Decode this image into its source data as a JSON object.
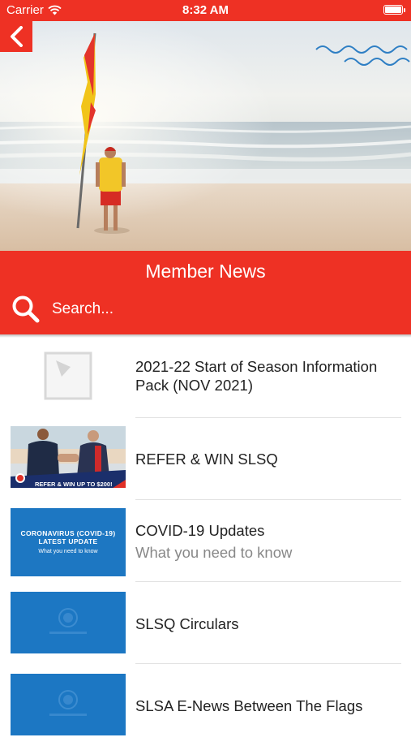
{
  "status_bar": {
    "carrier": "Carrier",
    "time": "8:32 AM",
    "battery_level": 1.0
  },
  "header": {
    "title": "Member News",
    "search_placeholder": "Search..."
  },
  "news_items": [
    {
      "title": "2021-22 Start of Season Information Pack (NOV 2021)",
      "subtitle": "",
      "thumbnail": "placeholder-image-icon"
    },
    {
      "title": "REFER & WIN SLSQ",
      "subtitle": "",
      "thumbnail": "refer-win-photo",
      "banner_text": "REFER & WIN UP TO $200!"
    },
    {
      "title": "COVID-19 Updates",
      "subtitle": "What you need to know",
      "thumbnail": "covid-banner",
      "thumb_line1": "CORONAVIRUS (COVID-19)",
      "thumb_line2": "LATEST UPDATE",
      "thumb_line3": "What you need to know"
    },
    {
      "title": "SLSQ Circulars",
      "subtitle": "",
      "thumbnail": "slsq-logo-blue"
    },
    {
      "title": "SLSA E-News Between The Flags",
      "subtitle": "",
      "thumbnail": "slsq-logo-blue"
    }
  ],
  "colors": {
    "brand_red": "#ee3124",
    "thumb_blue": "#1c77c3"
  }
}
